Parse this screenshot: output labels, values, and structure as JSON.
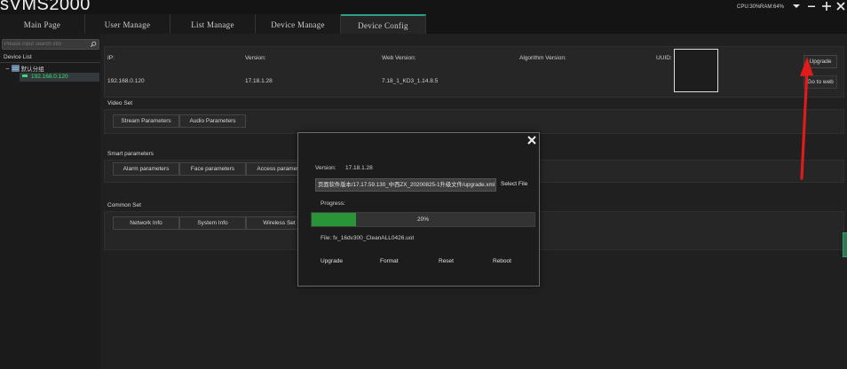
{
  "app": {
    "title": "sVMS2000",
    "cpu": "CPU:30%",
    "ram": "RAM:64%"
  },
  "window_controls": [
    "dropdown-icon",
    "minimize-icon",
    "maximize-icon",
    "close-icon"
  ],
  "tabs": [
    {
      "label": "Main Page"
    },
    {
      "label": "User Manage"
    },
    {
      "label": "List Manage"
    },
    {
      "label": "Device Manage"
    },
    {
      "label": "Device Config",
      "active": true
    }
  ],
  "sidebar": {
    "search_placeholder": "Please input search info",
    "title": "Device List",
    "group": "默认分组",
    "device": "192.168.0.120"
  },
  "device_info": {
    "ip_label": "IP:",
    "ip": "192.168.0.120",
    "version_label": "Version:",
    "version": "17.18.1.28",
    "web_version_label": "Web Version:",
    "web_version": "7.18_1_KD3_1.14.8.5",
    "algorithm_label": "Algorithm Version:",
    "uuid_label": "UUID:",
    "upgrade_button": "Upgrade",
    "goto_web_button": "Go to web"
  },
  "video_set": {
    "title": "Video Set",
    "buttons": [
      "Stream Parameters",
      "Audio Parameters"
    ]
  },
  "smart_parameters": {
    "title": "Smart parameters",
    "buttons": [
      "Alarm parameters",
      "Face parameters",
      "Access paramete"
    ]
  },
  "common_set": {
    "title": "Common Set",
    "buttons": [
      "Network Info",
      "System Info",
      "Wireless Set"
    ]
  },
  "upgrade_dialog": {
    "version_label": "Version:",
    "version": "17.18.1.28",
    "file_path": "页面软件版本/17.17.59.130_中西ZX_20200825-1升级文件/upgrade.xml",
    "select_file": "Select File",
    "progress_label": "Progress:",
    "progress_percent": 20,
    "progress_text": "20%",
    "file_label": "File: fx_16dv300_CleanALL0426.uot",
    "buttons": [
      "Upgrade",
      "Format",
      "Reset",
      "Reboot"
    ]
  },
  "colors": {
    "accent": "#2e9d8a",
    "progress": "#2a9438",
    "device_text": "#2ee36b",
    "arrow": "#e01b1b"
  }
}
